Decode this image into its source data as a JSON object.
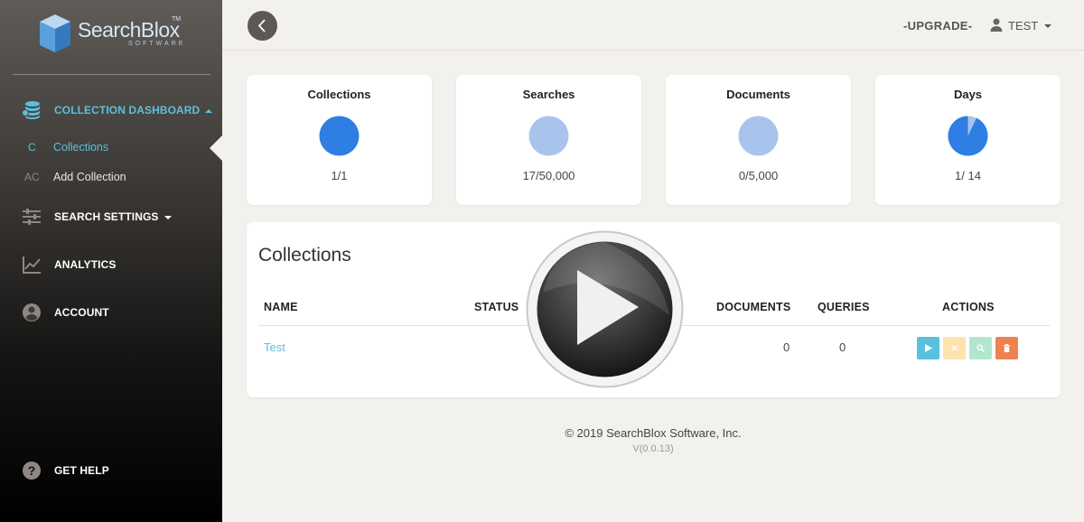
{
  "logo": {
    "name": "SearchBlox",
    "tm": "TM",
    "sub": "SOFTWARE"
  },
  "sidebar": {
    "items": [
      {
        "label": "COLLECTION DASHBOARD"
      },
      {
        "label": "SEARCH SETTINGS"
      },
      {
        "label": "ANALYTICS"
      },
      {
        "label": "ACCOUNT"
      },
      {
        "label": "GET HELP"
      }
    ],
    "subitems": [
      {
        "abbr": "C",
        "label": "Collections"
      },
      {
        "abbr": "AC",
        "label": "Add Collection"
      }
    ]
  },
  "topbar": {
    "upgrade": "-UPGRADE-",
    "user": "TEST"
  },
  "stats": [
    {
      "title": "Collections",
      "value": "1/1",
      "fraction": 1.0,
      "color": "#2e7ee3"
    },
    {
      "title": "Searches",
      "value": "17/50,000",
      "fraction": 0.00034,
      "color": "#a9c4ec"
    },
    {
      "title": "Documents",
      "value": "0/5,000",
      "fraction": 0.0,
      "color": "#a9c4ec"
    },
    {
      "title": "Days",
      "value": "1/ 14",
      "fraction": 0.0714,
      "color": "#2e7ee3"
    }
  ],
  "collections": {
    "title": "Collections",
    "headers": {
      "name": "NAME",
      "status": "STATUS",
      "documents": "DOCUMENTS",
      "queries": "QUERIES",
      "actions": "ACTIONS"
    },
    "rows": [
      {
        "name": "Test",
        "documents": "0",
        "queries": "0"
      }
    ]
  },
  "actions": {
    "start_color": "#5bc0de",
    "stop_color": "#fde3b0",
    "search_color": "#b4e6cf",
    "delete_color": "#ef8150"
  },
  "footer": {
    "copyright": "© 2019 SearchBlox Software, Inc.",
    "version": "V(0.0.13)"
  }
}
